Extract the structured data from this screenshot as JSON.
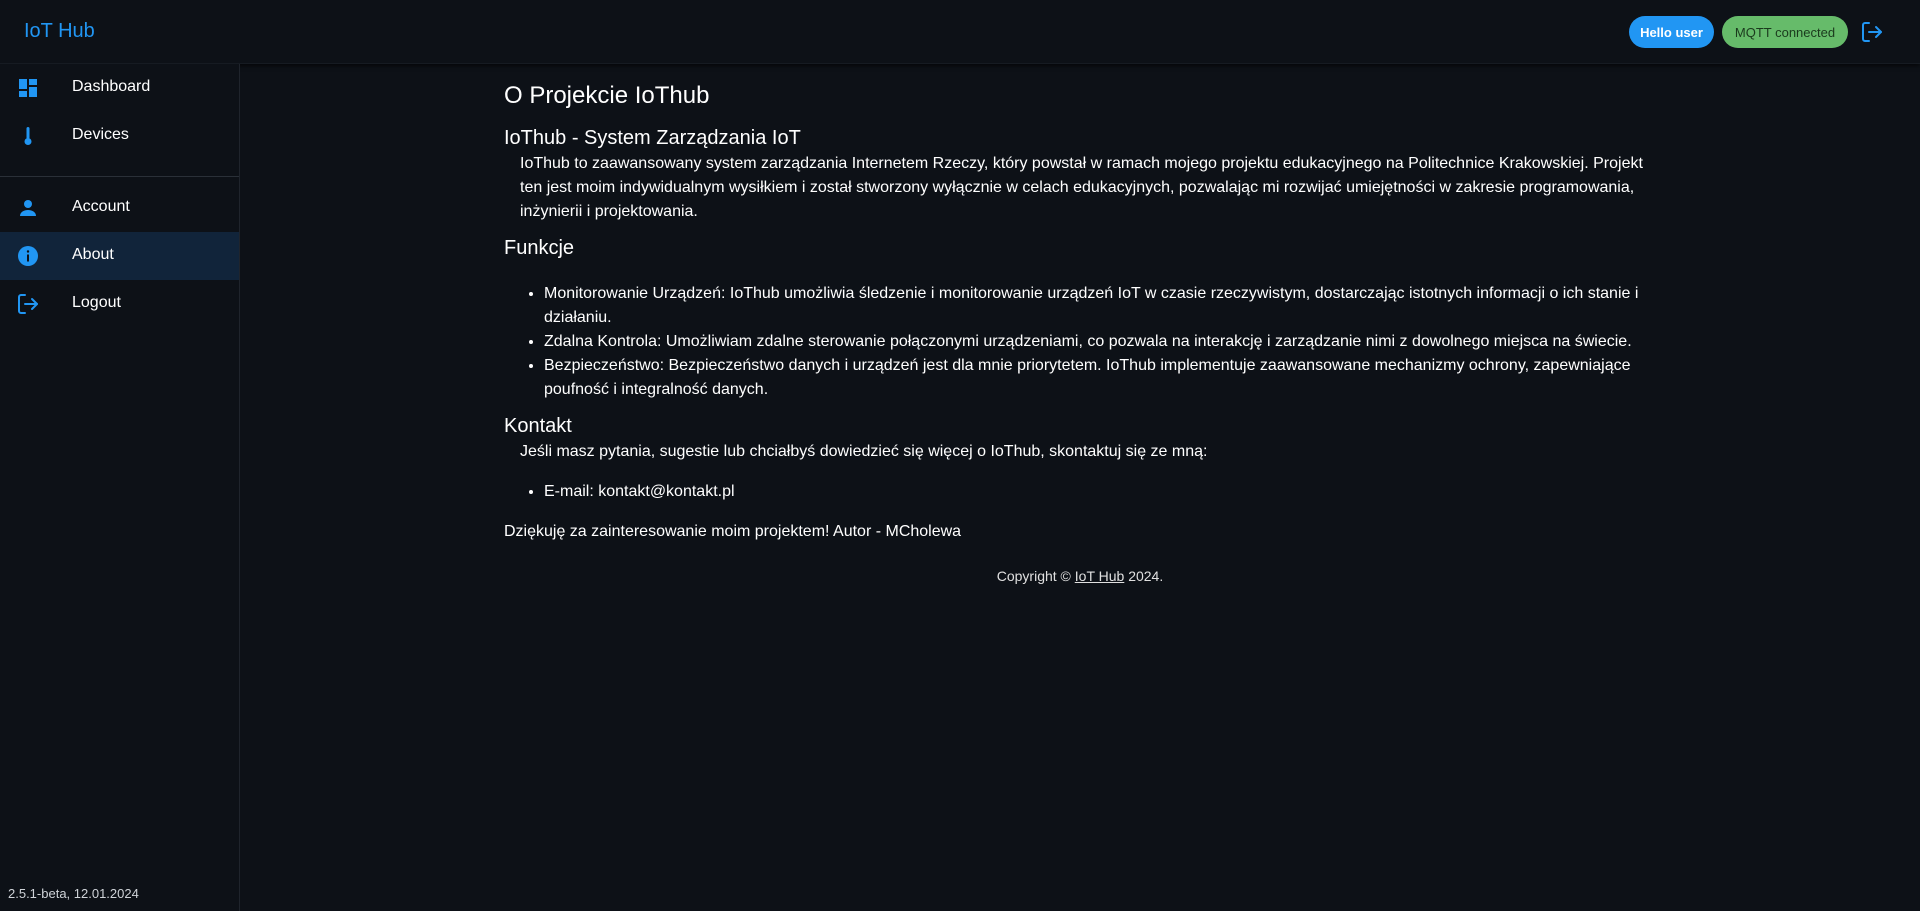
{
  "header": {
    "brand": "IoT Hub",
    "hello_badge": "Hello user",
    "mqtt_badge": "MQTT connected",
    "logout_icon": "logout-icon"
  },
  "sidebar": {
    "items": [
      {
        "label": "Dashboard",
        "icon": "dashboard-icon"
      },
      {
        "label": "Devices",
        "icon": "thermometer-icon"
      },
      {
        "label": "Account",
        "icon": "person-icon"
      },
      {
        "label": "About",
        "icon": "info-icon",
        "active": true
      },
      {
        "label": "Logout",
        "icon": "logout-icon"
      }
    ],
    "version": "2.5.1-beta, 12.01.2024"
  },
  "main": {
    "title": "O Projekcie IoThub",
    "subtitle": "IoThub - System Zarządzania IoT",
    "intro": "IoThub to zaawansowany system zarządzania Internetem Rzeczy, który powstał w ramach mojego projektu edukacyjnego na Politechnice Krakowskiej. Projekt ten jest moim indywidualnym wysiłkiem i został stworzony wyłącznie w celach edukacyjnych, pozwalając mi rozwijać umiejętności w zakresie programowania, inżynierii i projektowania.",
    "features_heading": "Funkcje",
    "features": [
      "Monitorowanie Urządzeń: IoThub umożliwia śledzenie i monitorowanie urządzeń IoT w czasie rzeczywistym, dostarczając istotnych informacji o ich stanie i działaniu.",
      "Zdalna Kontrola: Umożliwiam zdalne sterowanie połączonymi urządzeniami, co pozwala na interakcję i zarządzanie nimi z dowolnego miejsca na świecie.",
      "Bezpieczeństwo: Bezpieczeństwo danych i urządzeń jest dla mnie priorytetem. IoThub implementuje zaawansowane mechanizmy ochrony, zapewniające poufność i integralność danych."
    ],
    "contact_heading": "Kontakt",
    "contact_intro": "Jeśli masz pytania, sugestie lub chciałbyś dowiedzieć się więcej o IoThub, skontaktuj się ze mną:",
    "email": "E-mail: kontakt@kontakt.pl",
    "thanks": "Dziękuję za zainteresowanie moim projektem! Autor - MCholewa",
    "copyright_prefix": "Copyright © ",
    "copyright_link": "IoT Hub",
    "copyright_suffix": " 2024."
  },
  "colors": {
    "accent": "#2196f3",
    "background": "#0d1117",
    "active_nav": "#11243a",
    "mqtt_green": "#66bb6a"
  }
}
